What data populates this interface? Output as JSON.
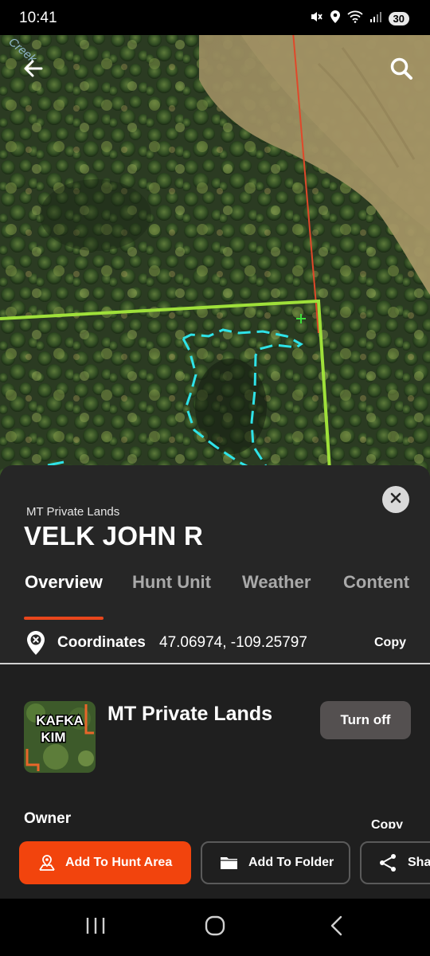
{
  "status_bar": {
    "time": "10:41",
    "battery": "30",
    "icons": [
      "mute-icon",
      "location-icon",
      "wifi-icon",
      "signal-icon"
    ]
  },
  "map": {
    "creek_label": "Creek",
    "back_icon": "arrow-left-icon",
    "search_icon": "search-icon",
    "boundary_color": "#9fe03a",
    "trail_color": "#2fe3e8",
    "line_color": "#e0482a"
  },
  "sheet": {
    "layer_label": "MT Private Lands",
    "title": "VELK JOHN R",
    "tabs": [
      {
        "label": "Overview",
        "active": true
      },
      {
        "label": "Hunt Unit",
        "active": false
      },
      {
        "label": "Weather",
        "active": false
      },
      {
        "label": "Content",
        "active": false
      }
    ],
    "coordinates": {
      "label": "Coordinates",
      "value": "47.06974, -109.25797",
      "copy": "Copy"
    },
    "layer": {
      "thumbnail_text_line1": "KAFKA",
      "thumbnail_text_line2": "KIM",
      "name": "MT Private Lands",
      "toggle_label": "Turn off"
    },
    "owner": {
      "label": "Owner",
      "copy": "Copy"
    }
  },
  "actions": {
    "add_to_hunt_area": "Add To Hunt Area",
    "add_to_folder": "Add To Folder",
    "share": "Sha"
  },
  "colors": {
    "accent": "#f2440d",
    "sheet_bg": "#262626"
  }
}
